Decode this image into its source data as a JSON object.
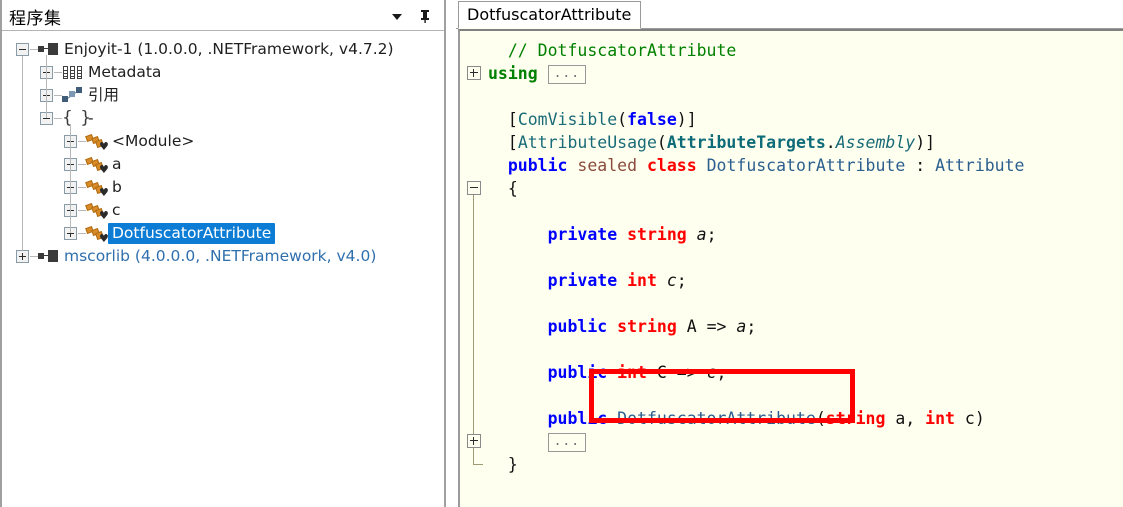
{
  "left_panel": {
    "title": "程序集",
    "dropdown_icon": "chevron-down-icon",
    "pin_icon": "pin-icon",
    "tree": [
      {
        "id": "assembly-enjoyit",
        "label": "Enjoyit-1 (1.0.0.0, .NETFramework, v4.7.2)",
        "icon": "assembly-icon",
        "expander": "minus",
        "depth": 0,
        "style": "normal"
      },
      {
        "id": "metadata",
        "label": "Metadata",
        "icon": "metadata-icon",
        "expander": "plus",
        "depth": 1,
        "style": "normal"
      },
      {
        "id": "references",
        "label": "引用",
        "icon": "references-icon",
        "expander": "plus",
        "depth": 1,
        "style": "normal"
      },
      {
        "id": "namespace-dash",
        "label": "-",
        "icon": "namespace-icon",
        "expander": "minus",
        "depth": 1,
        "style": "normal"
      },
      {
        "id": "type-module",
        "label": "<Module>",
        "icon": "class-icon",
        "expander": "plus",
        "depth": 2,
        "style": "normal"
      },
      {
        "id": "type-a",
        "label": "a",
        "icon": "class-icon",
        "expander": "plus",
        "depth": 2,
        "style": "normal"
      },
      {
        "id": "type-b",
        "label": "b",
        "icon": "class-icon",
        "expander": "plus",
        "depth": 2,
        "style": "normal"
      },
      {
        "id": "type-c",
        "label": "c",
        "icon": "class-icon",
        "expander": "plus",
        "depth": 2,
        "style": "normal"
      },
      {
        "id": "type-dotfuscatorattribute",
        "label": "DotfuscatorAttribute",
        "icon": "class-icon",
        "expander": "plus",
        "depth": 2,
        "style": "selected"
      },
      {
        "id": "assembly-mscorlib",
        "label": "mscorlib (4.0.0.0, .NETFramework, v4.0)",
        "icon": "assembly-icon",
        "expander": "plus",
        "depth": 0,
        "style": "link"
      }
    ]
  },
  "right_panel": {
    "tab_label": "DotfuscatorAttribute",
    "code_lines": [
      {
        "n": 0,
        "tokens": [
          {
            "t": "  // DotfuscatorAttribute",
            "c": "k-comment"
          }
        ]
      },
      {
        "n": 1,
        "fold": "plus",
        "tokens": [
          {
            "t": "using ",
            "c": "k-using"
          },
          {
            "t": "...",
            "c": "dots"
          }
        ]
      },
      {
        "n": 2,
        "tokens": []
      },
      {
        "n": 3,
        "tokens": [
          {
            "t": "  [",
            "c": "k-punct"
          },
          {
            "t": "ComVisible",
            "c": "k-attr"
          },
          {
            "t": "(",
            "c": "k-punct"
          },
          {
            "t": "false",
            "c": "k-kw"
          },
          {
            "t": ")]",
            "c": "k-punct"
          }
        ]
      },
      {
        "n": 4,
        "tokens": [
          {
            "t": "  [",
            "c": "k-punct"
          },
          {
            "t": "AttributeUsage",
            "c": "k-attr"
          },
          {
            "t": "(",
            "c": "k-punct"
          },
          {
            "t": "AttributeTargets",
            "c": "k-attrb"
          },
          {
            "t": ".",
            "c": "k-punct"
          },
          {
            "t": "Assembly",
            "c": "k-ital"
          },
          {
            "t": ")]",
            "c": "k-punct"
          }
        ]
      },
      {
        "n": 5,
        "tokens": [
          {
            "t": "  ",
            "c": "k-punct"
          },
          {
            "t": "public",
            "c": "k-kw"
          },
          {
            "t": " ",
            "c": "k-punct"
          },
          {
            "t": "sealed",
            "c": "k-sealed"
          },
          {
            "t": " ",
            "c": "k-punct"
          },
          {
            "t": "class",
            "c": "k-class"
          },
          {
            "t": " ",
            "c": "k-punct"
          },
          {
            "t": "DotfuscatorAttribute",
            "c": "k-type"
          },
          {
            "t": " : ",
            "c": "k-punct"
          },
          {
            "t": "Attribute",
            "c": "k-type"
          }
        ]
      },
      {
        "n": 6,
        "fold": "minus",
        "tokens": [
          {
            "t": "  {",
            "c": "k-brace"
          }
        ]
      },
      {
        "n": 7,
        "tokens": []
      },
      {
        "n": 8,
        "tokens": [
          {
            "t": "      ",
            "c": "k-punct"
          },
          {
            "t": "private",
            "c": "k-kw"
          },
          {
            "t": " ",
            "c": "k-punct"
          },
          {
            "t": "string",
            "c": "k-prim"
          },
          {
            "t": " ",
            "c": "k-punct"
          },
          {
            "t": "a",
            "c": "k-field"
          },
          {
            "t": ";",
            "c": "k-punct"
          }
        ]
      },
      {
        "n": 9,
        "tokens": []
      },
      {
        "n": 10,
        "tokens": [
          {
            "t": "      ",
            "c": "k-punct"
          },
          {
            "t": "private",
            "c": "k-kw"
          },
          {
            "t": " ",
            "c": "k-punct"
          },
          {
            "t": "int",
            "c": "k-prim"
          },
          {
            "t": " ",
            "c": "k-punct"
          },
          {
            "t": "c",
            "c": "k-field"
          },
          {
            "t": ";",
            "c": "k-punct"
          }
        ]
      },
      {
        "n": 11,
        "tokens": []
      },
      {
        "n": 12,
        "tokens": [
          {
            "t": "      ",
            "c": "k-punct"
          },
          {
            "t": "public",
            "c": "k-kw"
          },
          {
            "t": " ",
            "c": "k-punct"
          },
          {
            "t": "string",
            "c": "k-prim"
          },
          {
            "t": " A => ",
            "c": "k-plain"
          },
          {
            "t": "a",
            "c": "k-field"
          },
          {
            "t": ";",
            "c": "k-punct"
          }
        ]
      },
      {
        "n": 13,
        "tokens": []
      },
      {
        "n": 14,
        "tokens": [
          {
            "t": "      ",
            "c": "k-punct"
          },
          {
            "t": "public",
            "c": "k-kw"
          },
          {
            "t": " ",
            "c": "k-punct"
          },
          {
            "t": "int",
            "c": "k-prim"
          },
          {
            "t": " C => ",
            "c": "k-plain"
          },
          {
            "t": "c",
            "c": "k-field"
          },
          {
            "t": ";",
            "c": "k-punct"
          }
        ]
      },
      {
        "n": 15,
        "tokens": []
      },
      {
        "n": 16,
        "tokens": [
          {
            "t": "      ",
            "c": "k-punct"
          },
          {
            "t": "public",
            "c": "k-kw"
          },
          {
            "t": " ",
            "c": "k-punct"
          },
          {
            "t": "DotfuscatorAttribute",
            "c": "k-type"
          },
          {
            "t": "(",
            "c": "k-punct"
          },
          {
            "t": "string",
            "c": "k-prim"
          },
          {
            "t": " a, ",
            "c": "k-plain"
          },
          {
            "t": "int",
            "c": "k-prim"
          },
          {
            "t": " c)",
            "c": "k-plain"
          }
        ]
      },
      {
        "n": 17,
        "fold": "plus",
        "tokens": [
          {
            "t": "      ",
            "c": "k-punct"
          },
          {
            "t": "...",
            "c": "dots"
          }
        ]
      },
      {
        "n": 18,
        "tokens": [
          {
            "t": "  }",
            "c": "k-brace"
          }
        ]
      }
    ]
  },
  "annotation": {
    "type": "red-rectangle-highlight",
    "color": "#ff0000",
    "targets_line": "public DotfuscatorAttribute(string a, int c)"
  }
}
